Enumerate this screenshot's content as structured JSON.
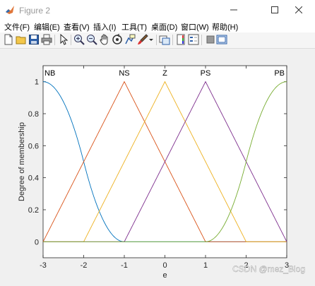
{
  "window": {
    "title": "Figure 2"
  },
  "menu": [
    "文件(F)",
    "编辑(E)",
    "查看(V)",
    "插入(I)",
    "工具(T)",
    "桌面(D)",
    "窗口(W)",
    "帮助(H)"
  ],
  "toolbar_icons": [
    "new-figure-icon",
    "open-file-icon",
    "save-icon",
    "print-icon",
    "pointer-icon",
    "zoom-in-icon",
    "zoom-out-icon",
    "pan-icon",
    "rotate-3d-icon",
    "data-cursor-icon",
    "brush-icon",
    "link-plot-icon",
    "colorbar-icon",
    "legend-icon",
    "hide-plot-tools-icon",
    "show-plot-tools-icon"
  ],
  "watermark": "CSDN @mez_Blog",
  "chart_data": {
    "type": "line",
    "xlabel": "e",
    "ylabel": "Degree of membership",
    "xlim": [
      -3,
      3
    ],
    "ylim": [
      -0.1,
      1.1
    ],
    "xticks": [
      -3,
      -2,
      -1,
      0,
      1,
      2,
      3
    ],
    "yticks": [
      0,
      0.2,
      0.4,
      0.6,
      0.8,
      1
    ],
    "grid": false,
    "series": [
      {
        "name": "NB",
        "shape": "zmf",
        "params": [
          -3,
          -1
        ],
        "color": "#0072BD",
        "label_x": -3
      },
      {
        "name": "NS",
        "shape": "trimf",
        "params": [
          -3,
          -1,
          1
        ],
        "color": "#D95319",
        "label_x": -1
      },
      {
        "name": "Z",
        "shape": "trimf",
        "params": [
          -2,
          0,
          2
        ],
        "color": "#EDB120",
        "label_x": 0
      },
      {
        "name": "PS",
        "shape": "trimf",
        "params": [
          -1,
          1,
          3
        ],
        "color": "#7E2F8E",
        "label_x": 1
      },
      {
        "name": "PB",
        "shape": "smf",
        "params": [
          1,
          3
        ],
        "color": "#77AC30",
        "label_x": 3
      }
    ]
  }
}
